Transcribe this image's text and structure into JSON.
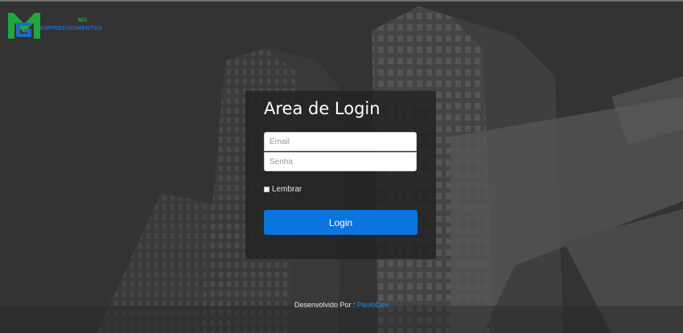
{
  "logo": {
    "line1": "MG",
    "line2": "EMPREENDIMENTOS"
  },
  "login": {
    "title": "Area de Login",
    "email_placeholder": "Email",
    "password_placeholder": "Senha",
    "remember_label": "Lembrar",
    "button_label": "Login"
  },
  "footer": {
    "prefix": "Desenvolvido Por :",
    "author": "PauloDev"
  },
  "colors": {
    "accent": "#0b74de",
    "link": "#1c8cf2",
    "logo_green": "#1fa83c",
    "logo_blue": "#1f69c7"
  }
}
